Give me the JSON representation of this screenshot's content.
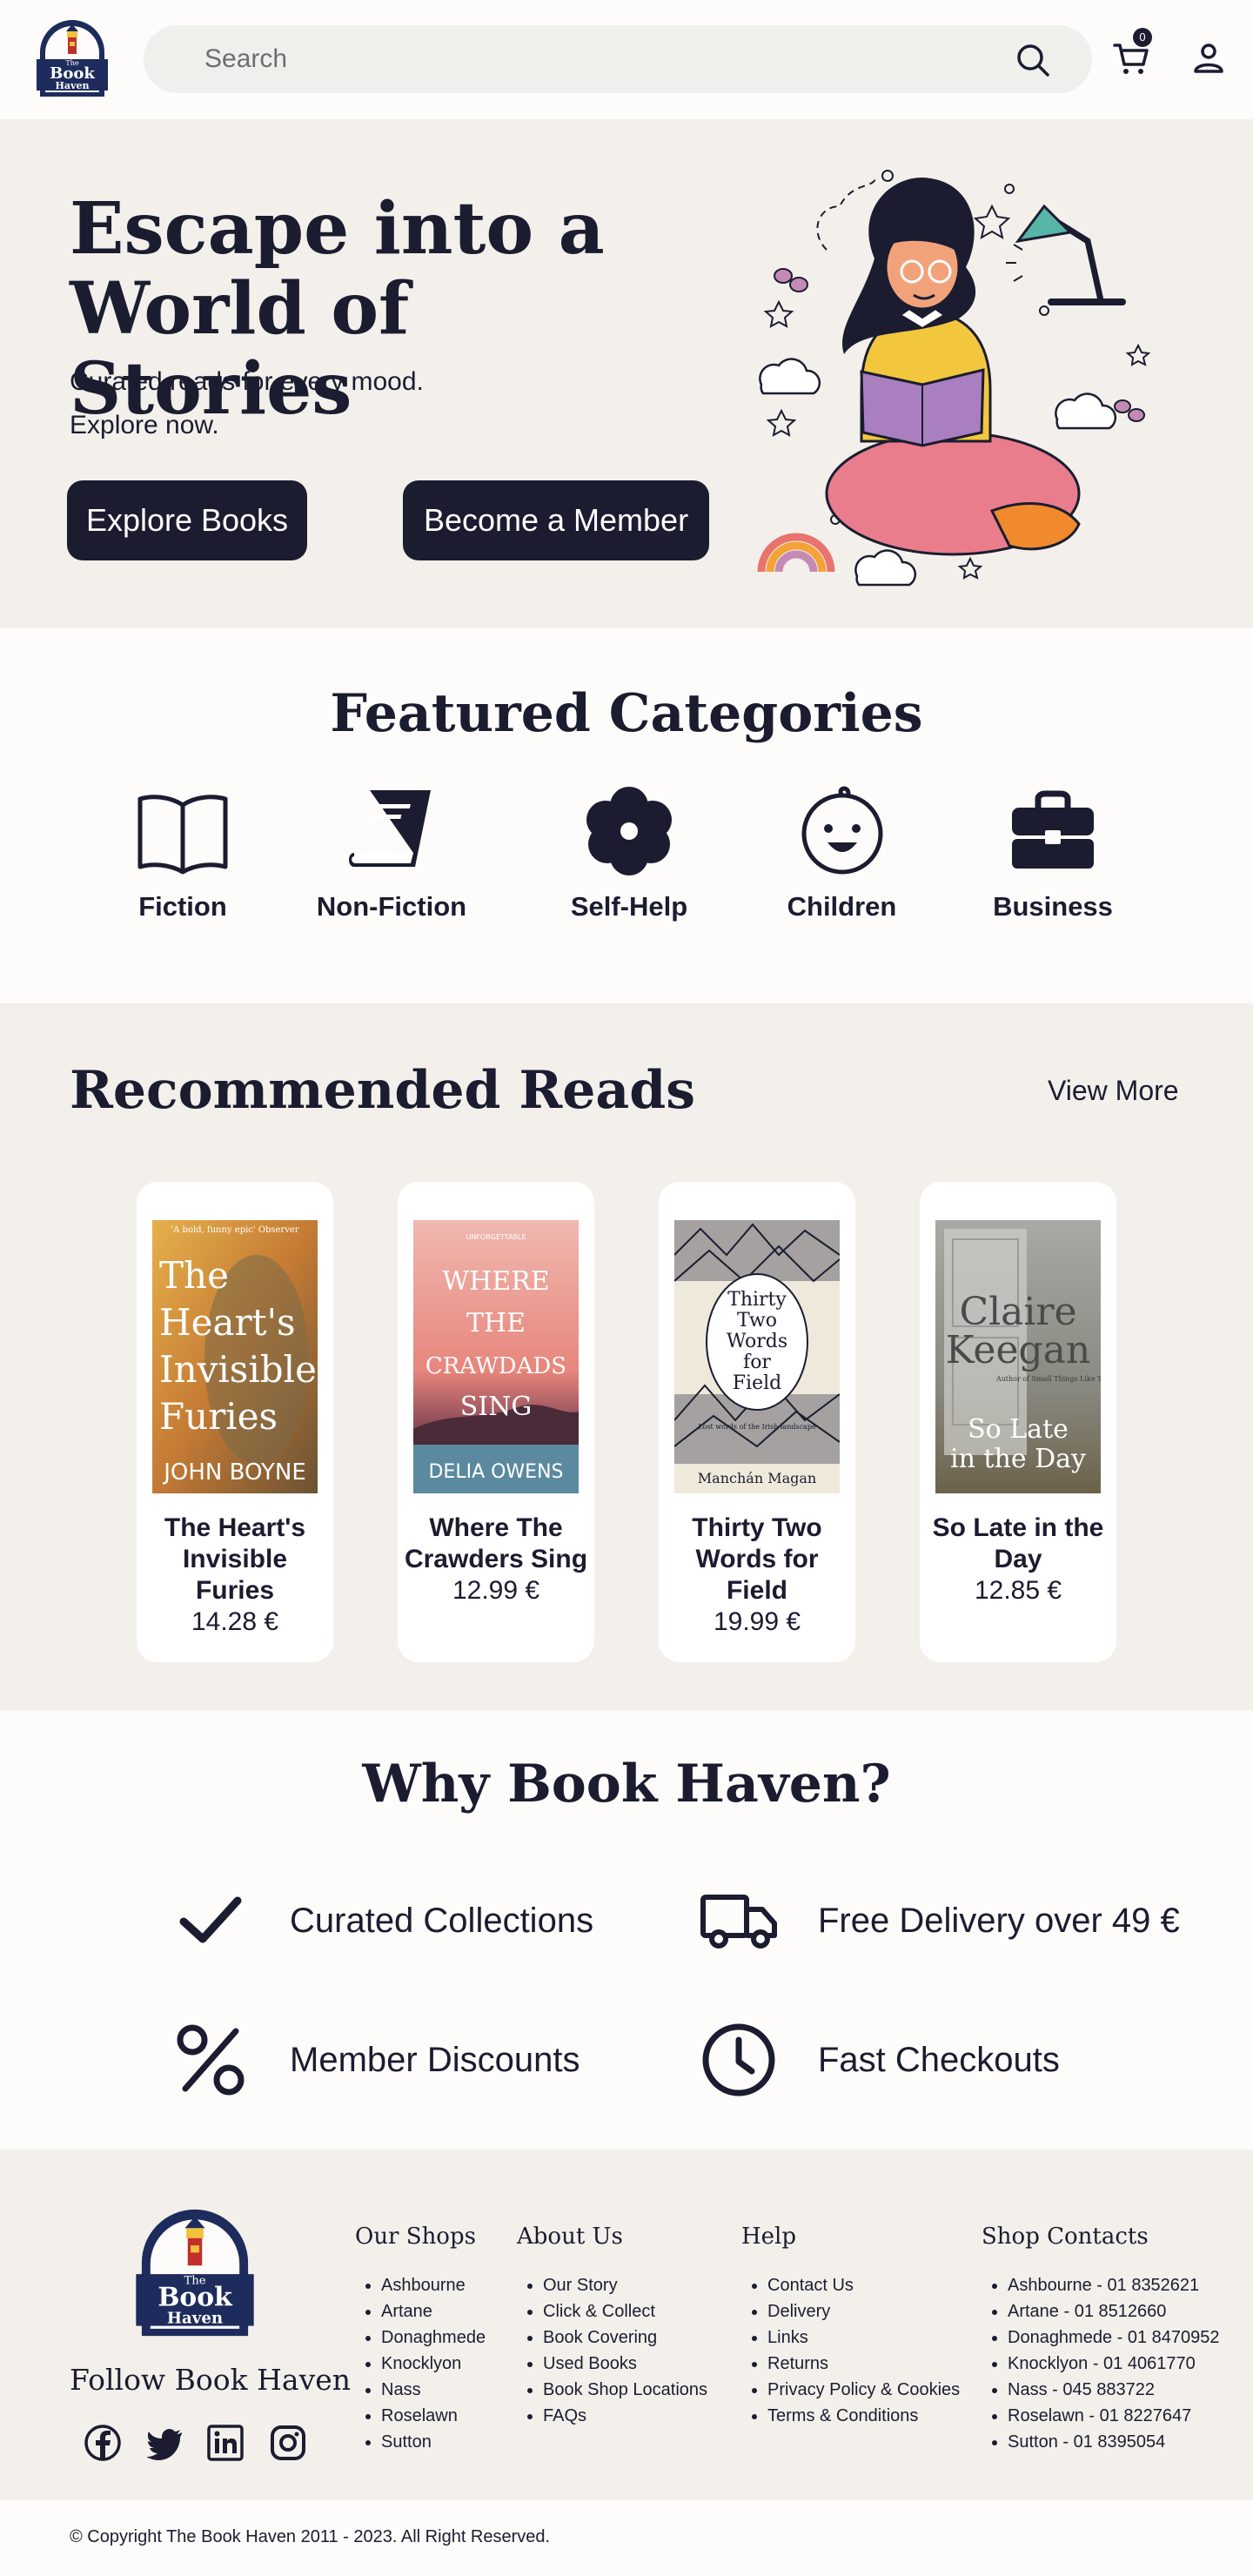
{
  "header": {
    "logo_text": [
      "The",
      "Book",
      "Haven"
    ],
    "search_placeholder": "Search",
    "cart_count": "0"
  },
  "hero": {
    "title_line1": "Escape into a",
    "title_line2": "World of Stories",
    "subtitle_line1": "Curated reads for every mood.",
    "subtitle_line2": "Explore now.",
    "explore_label": "Explore Books",
    "member_label": "Become a Member"
  },
  "categories": {
    "title": "Featured Categories",
    "items": [
      {
        "label": "Fiction",
        "icon": "open-book-icon"
      },
      {
        "label": "Non-Fiction",
        "icon": "closed-book-icon"
      },
      {
        "label": "Self-Help",
        "icon": "flower-icon"
      },
      {
        "label": "Children",
        "icon": "baby-face-icon"
      },
      {
        "label": "Business",
        "icon": "briefcase-icon"
      }
    ]
  },
  "recommended": {
    "title": "Recommended Reads",
    "view_more": "View More",
    "books": [
      {
        "title": "The Heart's Invisible Furies",
        "price": "14.28 €",
        "cover_text": {
          "quote": "'A bold, funny epic' Observer",
          "title_lines": [
            "The",
            "Heart's",
            "Invisible",
            "Furies"
          ],
          "author": "JOHN BOYNE"
        }
      },
      {
        "title": "Where The Crawders Sing",
        "price": "12.99 €",
        "cover_text": {
          "tag": "UNFORGETTABLE",
          "title_lines": [
            "WHERE",
            "THE",
            "CRAWDADS",
            "SING"
          ],
          "author": "DELIA OWENS"
        }
      },
      {
        "title": "Thirty Two Words for Field",
        "price": "19.99 €",
        "cover_text": {
          "title_lines": [
            "Thirty",
            "Two",
            "Words",
            "for",
            "Field"
          ],
          "subtitle": "Lost words of the Irish landscape",
          "author": "Manchán Magan"
        }
      },
      {
        "title": "So Late in the Day",
        "price": "12.85 €",
        "cover_text": {
          "title_lines": [
            "Claire",
            "Keegan"
          ],
          "subtitle_lines": [
            "So Late",
            "in the Day"
          ],
          "tag": "Author of Small Things Like These"
        }
      }
    ]
  },
  "why": {
    "title": "Why Book Haven?",
    "items": [
      {
        "label": "Curated Collections",
        "icon": "check-icon"
      },
      {
        "label": "Free Delivery over 49 €",
        "icon": "truck-icon"
      },
      {
        "label": "Member Discounts",
        "icon": "percent-icon"
      },
      {
        "label": "Fast Checkouts",
        "icon": "clock-icon"
      }
    ]
  },
  "footer": {
    "follow_label": "Follow Book Haven",
    "socials": [
      "facebook-icon",
      "twitter-icon",
      "linkedin-icon",
      "instagram-icon"
    ],
    "columns": [
      {
        "heading": "Our Shops",
        "items": [
          "Ashbourne",
          "Artane",
          "Donaghmede",
          "Knocklyon",
          "Nass",
          "Roselawn",
          "Sutton"
        ]
      },
      {
        "heading": "About Us",
        "items": [
          "Our Story",
          "Click & Collect",
          "Book Covering",
          "Used Books",
          "Book Shop Locations",
          "FAQs"
        ]
      },
      {
        "heading": "Help",
        "items": [
          "Contact Us",
          "Delivery",
          "Links",
          "Returns",
          "Privacy Policy & Cookies",
          "Terms & Conditions"
        ]
      },
      {
        "heading": "Shop Contacts",
        "items": [
          "Ashbourne - 01 8352621",
          "Artane - 01 8512660",
          "Donaghmede - 01 8470952",
          "Knocklyon - 01 4061770",
          "Nass - 045 883722",
          "Roselawn - 01 8227647",
          "Sutton - 01 8395054"
        ]
      }
    ],
    "copyright": "© Copyright The Book Haven 2011 - 2023. All Right Reserved."
  },
  "colors": {
    "ink": "#1b1c30",
    "cream": "#f3f0eb",
    "search_bg": "#efefec"
  }
}
